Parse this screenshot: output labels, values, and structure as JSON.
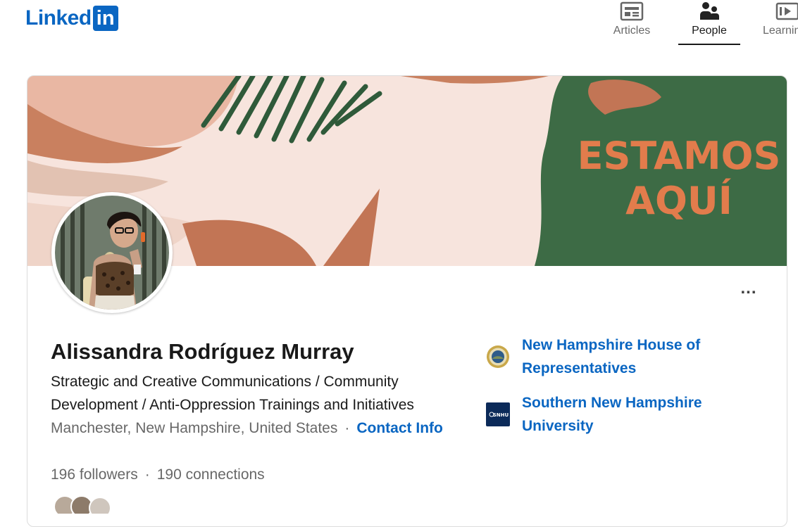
{
  "header": {
    "logo_word": "Linked",
    "logo_box": "in",
    "nav": [
      {
        "label": "Articles",
        "icon": "articles-icon"
      },
      {
        "label": "People",
        "icon": "people-icon",
        "active": true
      },
      {
        "label": "Learning",
        "icon": "learning-icon"
      }
    ]
  },
  "profile": {
    "banner_text_line1": "ESTAMOS",
    "banner_text_line2": "AQUÍ",
    "name": "Alissandra Rodríguez Murray",
    "headline": "Strategic and Creative Communications / Community Development / Anti-Oppression Trainings and Initiatives",
    "location": "Manchester, New Hampshire, United States",
    "separator": "·",
    "contact_info": "Contact Info",
    "followers": "196 followers",
    "connections": "190 connections",
    "more_label": "...",
    "organizations": [
      {
        "name": "New Hampshire House of Representatives",
        "logo": "nh-house-seal-icon"
      },
      {
        "name": "Southern New Hampshire University",
        "logo": "snhu-logo-icon",
        "logo_text": "SNHU"
      }
    ]
  },
  "colors": {
    "brand": "#0a66c2",
    "banner_bg": "#f7e4dd",
    "banner_leaf": "#3d6b45",
    "banner_text": "#e27c4c"
  }
}
